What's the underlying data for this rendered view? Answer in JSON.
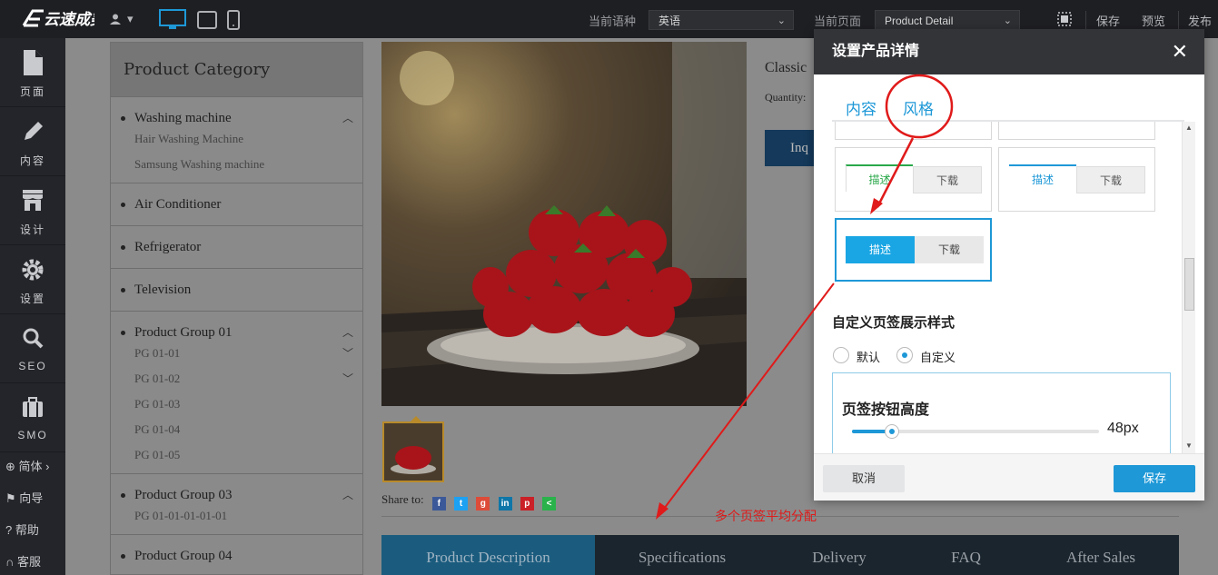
{
  "topbar": {
    "logo_text": "云速成美站",
    "language_label": "当前语种",
    "language_value": "英语",
    "page_label": "当前页面",
    "page_value": "Product Detail",
    "save": "保存",
    "preview": "预览",
    "publish": "发布"
  },
  "sidebar": {
    "items": [
      {
        "label": "页面",
        "icon": "page-icon"
      },
      {
        "label": "内容",
        "icon": "pencil-icon"
      },
      {
        "label": "设计",
        "icon": "store-icon"
      },
      {
        "label": "设置",
        "icon": "gear-icon"
      },
      {
        "label": "SEO",
        "icon": "search-icon"
      },
      {
        "label": "SMO",
        "icon": "briefcase-icon"
      }
    ],
    "small": [
      {
        "label": "简体 ›",
        "icon": "globe-icon"
      },
      {
        "label": "向导",
        "icon": "flag-icon"
      },
      {
        "label": "帮助",
        "icon": "help-icon"
      },
      {
        "label": "客服",
        "icon": "headset-icon"
      }
    ]
  },
  "category": {
    "title": "Product Category",
    "groups": [
      {
        "name": "Washing machine",
        "subs": [
          "Hair Washing Machine",
          "Samsung Washing machine"
        ]
      },
      {
        "name": "Air Conditioner",
        "subs": []
      },
      {
        "name": "Refrigerator",
        "subs": []
      },
      {
        "name": "Television",
        "subs": []
      },
      {
        "name": "Product Group 01",
        "subs": [
          "PG 01-01",
          "PG 01-02",
          "PG 01-03",
          "PG 01-04",
          "PG 01-05"
        ]
      },
      {
        "name": "Product Group 03",
        "subs": [
          "PG 01-01-01-01-01"
        ]
      },
      {
        "name": "Product Group 04",
        "subs": []
      }
    ]
  },
  "product": {
    "title": "Classic",
    "quantity_label": "Quantity:",
    "inquire": "Inq",
    "share_label": "Share to:"
  },
  "detail_tabs": [
    "Product Description",
    "Specifications",
    "Delivery",
    "FAQ",
    "After Sales"
  ],
  "annotation": "多个页签平均分配",
  "dialog": {
    "title": "设置产品详情",
    "tabs": [
      "内容",
      "风格"
    ],
    "style_cards": [
      {
        "tab1": "描述",
        "tab2": "下载"
      },
      {
        "tab1": "描述",
        "tab2": "下载"
      },
      {
        "tab1": "描述",
        "tab2": "下载"
      }
    ],
    "section_title": "自定义页签展示样式",
    "radio_default": "默认",
    "radio_custom": "自定义",
    "height_label": "页签按钮高度",
    "height_value": "48px",
    "height_fraction": 0.16,
    "cancel": "取消",
    "save": "保存"
  },
  "colors": {
    "accent": "#1e98d7",
    "annotation": "#e01a1a",
    "topbar": "#1e1f23"
  }
}
